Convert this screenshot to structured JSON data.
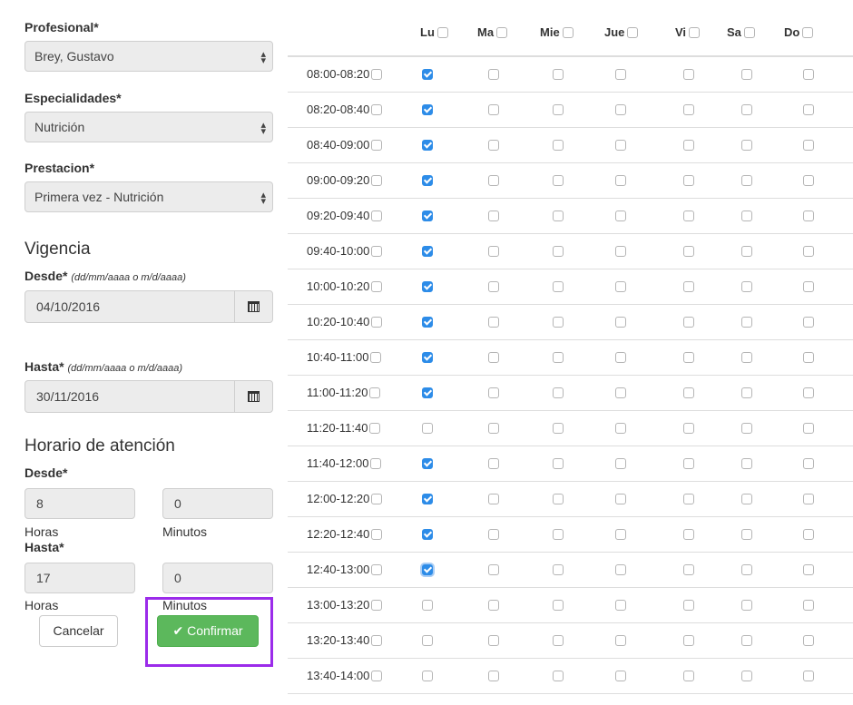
{
  "form": {
    "profesional_label": "Profesional*",
    "profesional_value": "Brey, Gustavo",
    "especialidades_label": "Especialidades*",
    "especialidades_value": "Nutrición",
    "prestacion_label": "Prestacion*",
    "prestacion_value": "Primera vez - Nutrición",
    "vigencia_title": "Vigencia",
    "desde_label": "Desde*",
    "desde_hint": "(dd/mm/aaaa o m/d/aaaa)",
    "desde_value": "04/10/2016",
    "hasta_label": "Hasta*",
    "hasta_hint": "(dd/mm/aaaa o m/d/aaaa)",
    "hasta_value": "30/11/2016",
    "horario_title": "Horario de atención",
    "horario_desde_label": "Desde*",
    "horario_desde_horas": "8",
    "horario_desde_minutos": "0",
    "horario_hasta_label": "Hasta*",
    "horario_hasta_horas": "17",
    "horario_hasta_minutos": "0",
    "horas_label": "Horas",
    "minutos_label": "Minutos",
    "cancel_label": "Cancelar",
    "confirm_label": "Confirmar"
  },
  "schedule": {
    "days": [
      "Lu",
      "Ma",
      "Mie",
      "Jue",
      "Vi",
      "Sa",
      "Do"
    ],
    "slots": [
      {
        "time": "08:00-08:20",
        "checked": [
          true,
          false,
          false,
          false,
          false,
          false,
          false
        ]
      },
      {
        "time": "08:20-08:40",
        "checked": [
          true,
          false,
          false,
          false,
          false,
          false,
          false
        ]
      },
      {
        "time": "08:40-09:00",
        "checked": [
          true,
          false,
          false,
          false,
          false,
          false,
          false
        ]
      },
      {
        "time": "09:00-09:20",
        "checked": [
          true,
          false,
          false,
          false,
          false,
          false,
          false
        ]
      },
      {
        "time": "09:20-09:40",
        "checked": [
          true,
          false,
          false,
          false,
          false,
          false,
          false
        ]
      },
      {
        "time": "09:40-10:00",
        "checked": [
          true,
          false,
          false,
          false,
          false,
          false,
          false
        ]
      },
      {
        "time": "10:00-10:20",
        "checked": [
          true,
          false,
          false,
          false,
          false,
          false,
          false
        ]
      },
      {
        "time": "10:20-10:40",
        "checked": [
          true,
          false,
          false,
          false,
          false,
          false,
          false
        ]
      },
      {
        "time": "10:40-11:00",
        "checked": [
          true,
          false,
          false,
          false,
          false,
          false,
          false
        ]
      },
      {
        "time": "11:00-11:20",
        "checked": [
          true,
          false,
          false,
          false,
          false,
          false,
          false
        ]
      },
      {
        "time": "11:20-11:40",
        "checked": [
          false,
          false,
          false,
          false,
          false,
          false,
          false
        ]
      },
      {
        "time": "11:40-12:00",
        "checked": [
          true,
          false,
          false,
          false,
          false,
          false,
          false
        ]
      },
      {
        "time": "12:00-12:20",
        "checked": [
          true,
          false,
          false,
          false,
          false,
          false,
          false
        ]
      },
      {
        "time": "12:20-12:40",
        "checked": [
          true,
          false,
          false,
          false,
          false,
          false,
          false
        ]
      },
      {
        "time": "12:40-13:00",
        "checked": [
          true,
          false,
          false,
          false,
          false,
          false,
          false
        ]
      },
      {
        "time": "13:00-13:20",
        "checked": [
          false,
          false,
          false,
          false,
          false,
          false,
          false
        ]
      },
      {
        "time": "13:20-13:40",
        "checked": [
          false,
          false,
          false,
          false,
          false,
          false,
          false
        ]
      },
      {
        "time": "13:40-14:00",
        "checked": [
          false,
          false,
          false,
          false,
          false,
          false,
          false
        ]
      }
    ]
  },
  "colors": {
    "checkbox_checked": "#2d8ce8",
    "confirm_button": "#5cb85c",
    "highlight_box": "#9b2bea"
  }
}
